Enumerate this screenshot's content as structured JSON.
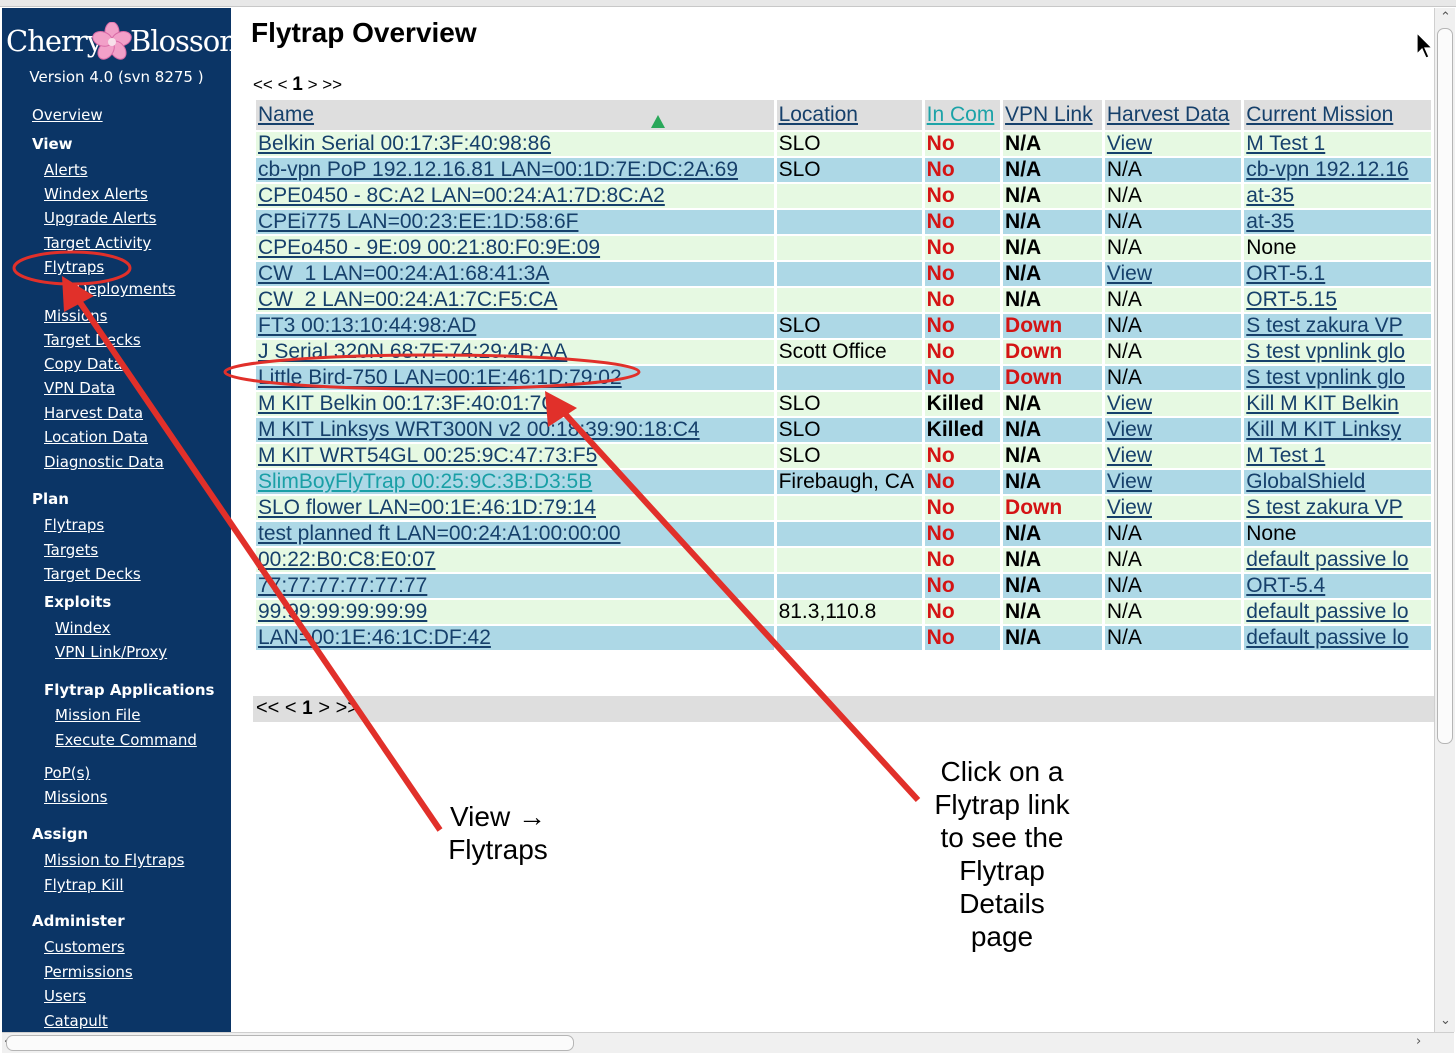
{
  "app": {
    "logo_word1": "Cherry",
    "logo_word2": "Blossom",
    "version": "Version 4.0 (svn 8275 )"
  },
  "sidebar": {
    "overview": "Overview",
    "view_header": "View",
    "alerts": "Alerts",
    "windex_alerts": "Windex Alerts",
    "upgrade_alerts": "Upgrade Alerts",
    "target_activity": "Target Activity",
    "flytraps": "Flytraps",
    "deployments": "Deployments",
    "missions": "Missions",
    "target_decks": "Target Decks",
    "copy_data": "Copy Data",
    "vpn_data": "VPN Data",
    "harvest_data": "Harvest Data",
    "location_data": "Location Data",
    "diagnostic_data": "Diagnostic Data",
    "plan_header": "Plan",
    "plan_flytraps": "Flytraps",
    "plan_targets": "Targets",
    "plan_target_decks": "Target Decks",
    "exploits_header": "Exploits",
    "windex": "Windex",
    "vpn_link_proxy": "VPN Link/Proxy",
    "flytrap_apps_header": "Flytrap Applications",
    "mission_file": "Mission File",
    "execute_command": "Execute Command",
    "pops": "PoP(s)",
    "plan_missions": "Missions",
    "assign_header": "Assign",
    "mission_to_flytraps": "Mission to Flytraps",
    "flytrap_kill": "Flytrap Kill",
    "administer_header": "Administer",
    "customers": "Customers",
    "permissions": "Permissions",
    "users": "Users",
    "catapult": "Catapult"
  },
  "main": {
    "title": "Flytrap Overview",
    "pager": {
      "first": "<<",
      "prev": "<",
      "page": "1",
      "next": ">",
      "last": ">>"
    },
    "columns": [
      "Name",
      "Location",
      "In Com",
      "VPN Link",
      "Harvest Data",
      "Current Mission"
    ],
    "rows": [
      {
        "name": "Belkin Serial 00:17:3F:40:98:86",
        "location": "SLO",
        "incom": "No",
        "vpn": "N/A",
        "harvest": "View",
        "mission": "M Test 1"
      },
      {
        "name": "cb-vpn PoP 192.12.16.81 LAN=00:1D:7E:DC:2A:69",
        "location": "SLO",
        "incom": "No",
        "vpn": "N/A",
        "harvest": "N/A",
        "mission": "cb-vpn 192.12.16"
      },
      {
        "name": "CPE0450 - 8C:A2 LAN=00:24:A1:7D:8C:A2",
        "location": "",
        "incom": "No",
        "vpn": "N/A",
        "harvest": "N/A",
        "mission": "at-35"
      },
      {
        "name": "CPEi775 LAN=00:23:EE:1D:58:6F",
        "location": "",
        "incom": "No",
        "vpn": "N/A",
        "harvest": "N/A",
        "mission": "at-35"
      },
      {
        "name": "CPEo450 - 9E:09 00:21:80:F0:9E:09",
        "location": "",
        "incom": "No",
        "vpn": "N/A",
        "harvest": "N/A",
        "mission": "None"
      },
      {
        "name": "CW_1 LAN=00:24:A1:68:41:3A",
        "location": "",
        "incom": "No",
        "vpn": "N/A",
        "harvest": "View",
        "mission": "ORT-5.1"
      },
      {
        "name": "CW_2 LAN=00:24:A1:7C:F5:CA",
        "location": "",
        "incom": "No",
        "vpn": "N/A",
        "harvest": "N/A",
        "mission": "ORT-5.15"
      },
      {
        "name": "FT3 00:13:10:44:98:AD",
        "location": "SLO",
        "incom": "No",
        "vpn": "Down",
        "harvest": "N/A",
        "mission": "S test zakura VP"
      },
      {
        "name": "J Serial 320N 68:7F:74:29:4B:AA",
        "location": "Scott Office",
        "incom": "No",
        "vpn": "Down",
        "harvest": "N/A",
        "mission": "S test vpnlink glo"
      },
      {
        "name": "Little Bird-750 LAN=00:1E:46:1D:79:02",
        "location": "",
        "incom": "No",
        "vpn": "Down",
        "harvest": "N/A",
        "mission": "S test vpnlink glo"
      },
      {
        "name": "M KIT Belkin 00:17:3F:40:01:7C",
        "location": "SLO",
        "incom": "Killed",
        "vpn": "N/A",
        "harvest": "View",
        "mission": "Kill M KIT Belkin"
      },
      {
        "name": "M KIT Linksys WRT300N v2 00:18:39:90:18:C4",
        "location": "SLO",
        "incom": "Killed",
        "vpn": "N/A",
        "harvest": "View",
        "mission": "Kill M KIT Linksy"
      },
      {
        "name": "M KIT WRT54GL 00:25:9C:47:73:F5",
        "location": "SLO",
        "incom": "No",
        "vpn": "N/A",
        "harvest": "View",
        "mission": "M Test 1"
      },
      {
        "name": "SlimBoyFlyTrap 00:25:9C:3B:D3:5B",
        "location": "Firebaugh, CA",
        "incom": "No",
        "vpn": "N/A",
        "harvest": "View",
        "mission": "GlobalShield"
      },
      {
        "name": "SLO flower LAN=00:1E:46:1D:79:14",
        "location": "",
        "incom": "No",
        "vpn": "Down",
        "harvest": "View",
        "mission": "S test zakura VP"
      },
      {
        "name": "test planned ft LAN=00:24:A1:00:00:00",
        "location": "",
        "incom": "No",
        "vpn": "N/A",
        "harvest": "N/A",
        "mission": "None"
      },
      {
        "name": "00:22:B0:C8:E0:07",
        "location": "",
        "incom": "No",
        "vpn": "N/A",
        "harvest": "N/A",
        "mission": "default passive lo"
      },
      {
        "name": "77:77:77:77:77:77",
        "location": "",
        "incom": "No",
        "vpn": "N/A",
        "harvest": "N/A",
        "mission": "ORT-5.4"
      },
      {
        "name": "99:99:99:99:99:99",
        "location": "81.3,110.8",
        "incom": "No",
        "vpn": "N/A",
        "harvest": "N/A",
        "mission": "default passive lo"
      },
      {
        "name": "LAN=00:1E:46:1C:DF:42",
        "location": "",
        "incom": "No",
        "vpn": "N/A",
        "harvest": "N/A",
        "mission": "default passive lo"
      }
    ]
  },
  "annotations": {
    "callout_view_l1": "View →",
    "callout_view_l2": "Flytraps",
    "callout_click": [
      "Click on a",
      "Flytrap link",
      "to see the",
      "Flytrap",
      "Details",
      "page"
    ]
  },
  "colors": {
    "sidebar_bg": "#0b3566",
    "row_odd": "#e6f9e2",
    "row_even": "#add8e6",
    "status_red": "#d41414",
    "annotation_red": "#e1302a"
  }
}
